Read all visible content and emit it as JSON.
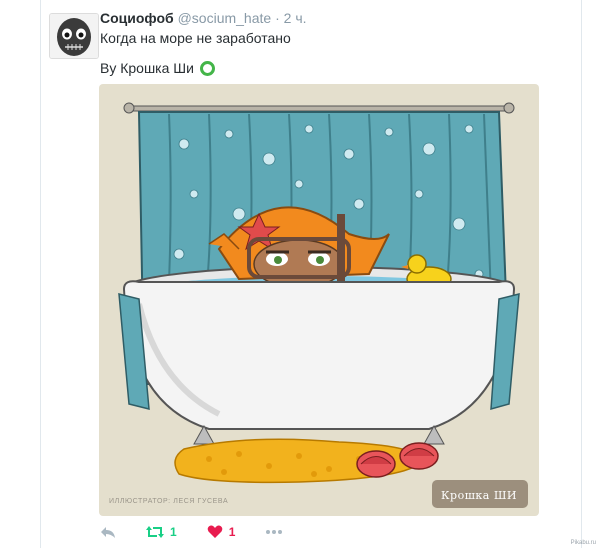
{
  "tweet": {
    "author_name": "Социофоб",
    "handle": "@socium_hate",
    "separator": "·",
    "time": "2 ч.",
    "text": "Когда на море не заработано",
    "via_label": "By Крошка Ши",
    "image": {
      "credit": "ИЛЛЮСТРАТОР: ЛЕСЯ ГУСЕВА",
      "badge": "Крошка ШИ"
    }
  },
  "actions": {
    "retweet_count": "1",
    "like_count": "1"
  },
  "watermark": "Pikabu.ru",
  "colors": {
    "retweet": "#19cf86",
    "like": "#e81c4f",
    "muted": "#8899a6",
    "via_icon": "#44b549"
  }
}
